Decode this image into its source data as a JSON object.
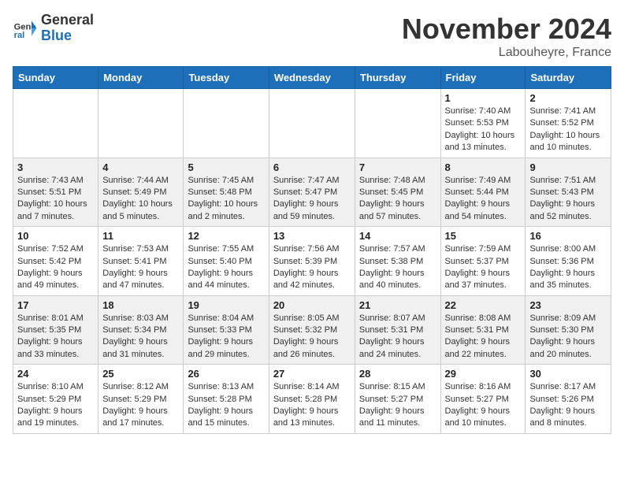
{
  "logo": {
    "general": "General",
    "blue": "Blue"
  },
  "title": "November 2024",
  "location": "Labouheyre, France",
  "days_of_week": [
    "Sunday",
    "Monday",
    "Tuesday",
    "Wednesday",
    "Thursday",
    "Friday",
    "Saturday"
  ],
  "weeks": [
    [
      {
        "day": "",
        "info": ""
      },
      {
        "day": "",
        "info": ""
      },
      {
        "day": "",
        "info": ""
      },
      {
        "day": "",
        "info": ""
      },
      {
        "day": "",
        "info": ""
      },
      {
        "day": "1",
        "info": "Sunrise: 7:40 AM\nSunset: 5:53 PM\nDaylight: 10 hours and 13 minutes."
      },
      {
        "day": "2",
        "info": "Sunrise: 7:41 AM\nSunset: 5:52 PM\nDaylight: 10 hours and 10 minutes."
      }
    ],
    [
      {
        "day": "3",
        "info": "Sunrise: 7:43 AM\nSunset: 5:51 PM\nDaylight: 10 hours and 7 minutes."
      },
      {
        "day": "4",
        "info": "Sunrise: 7:44 AM\nSunset: 5:49 PM\nDaylight: 10 hours and 5 minutes."
      },
      {
        "day": "5",
        "info": "Sunrise: 7:45 AM\nSunset: 5:48 PM\nDaylight: 10 hours and 2 minutes."
      },
      {
        "day": "6",
        "info": "Sunrise: 7:47 AM\nSunset: 5:47 PM\nDaylight: 9 hours and 59 minutes."
      },
      {
        "day": "7",
        "info": "Sunrise: 7:48 AM\nSunset: 5:45 PM\nDaylight: 9 hours and 57 minutes."
      },
      {
        "day": "8",
        "info": "Sunrise: 7:49 AM\nSunset: 5:44 PM\nDaylight: 9 hours and 54 minutes."
      },
      {
        "day": "9",
        "info": "Sunrise: 7:51 AM\nSunset: 5:43 PM\nDaylight: 9 hours and 52 minutes."
      }
    ],
    [
      {
        "day": "10",
        "info": "Sunrise: 7:52 AM\nSunset: 5:42 PM\nDaylight: 9 hours and 49 minutes."
      },
      {
        "day": "11",
        "info": "Sunrise: 7:53 AM\nSunset: 5:41 PM\nDaylight: 9 hours and 47 minutes."
      },
      {
        "day": "12",
        "info": "Sunrise: 7:55 AM\nSunset: 5:40 PM\nDaylight: 9 hours and 44 minutes."
      },
      {
        "day": "13",
        "info": "Sunrise: 7:56 AM\nSunset: 5:39 PM\nDaylight: 9 hours and 42 minutes."
      },
      {
        "day": "14",
        "info": "Sunrise: 7:57 AM\nSunset: 5:38 PM\nDaylight: 9 hours and 40 minutes."
      },
      {
        "day": "15",
        "info": "Sunrise: 7:59 AM\nSunset: 5:37 PM\nDaylight: 9 hours and 37 minutes."
      },
      {
        "day": "16",
        "info": "Sunrise: 8:00 AM\nSunset: 5:36 PM\nDaylight: 9 hours and 35 minutes."
      }
    ],
    [
      {
        "day": "17",
        "info": "Sunrise: 8:01 AM\nSunset: 5:35 PM\nDaylight: 9 hours and 33 minutes."
      },
      {
        "day": "18",
        "info": "Sunrise: 8:03 AM\nSunset: 5:34 PM\nDaylight: 9 hours and 31 minutes."
      },
      {
        "day": "19",
        "info": "Sunrise: 8:04 AM\nSunset: 5:33 PM\nDaylight: 9 hours and 29 minutes."
      },
      {
        "day": "20",
        "info": "Sunrise: 8:05 AM\nSunset: 5:32 PM\nDaylight: 9 hours and 26 minutes."
      },
      {
        "day": "21",
        "info": "Sunrise: 8:07 AM\nSunset: 5:31 PM\nDaylight: 9 hours and 24 minutes."
      },
      {
        "day": "22",
        "info": "Sunrise: 8:08 AM\nSunset: 5:31 PM\nDaylight: 9 hours and 22 minutes."
      },
      {
        "day": "23",
        "info": "Sunrise: 8:09 AM\nSunset: 5:30 PM\nDaylight: 9 hours and 20 minutes."
      }
    ],
    [
      {
        "day": "24",
        "info": "Sunrise: 8:10 AM\nSunset: 5:29 PM\nDaylight: 9 hours and 19 minutes."
      },
      {
        "day": "25",
        "info": "Sunrise: 8:12 AM\nSunset: 5:29 PM\nDaylight: 9 hours and 17 minutes."
      },
      {
        "day": "26",
        "info": "Sunrise: 8:13 AM\nSunset: 5:28 PM\nDaylight: 9 hours and 15 minutes."
      },
      {
        "day": "27",
        "info": "Sunrise: 8:14 AM\nSunset: 5:28 PM\nDaylight: 9 hours and 13 minutes."
      },
      {
        "day": "28",
        "info": "Sunrise: 8:15 AM\nSunset: 5:27 PM\nDaylight: 9 hours and 11 minutes."
      },
      {
        "day": "29",
        "info": "Sunrise: 8:16 AM\nSunset: 5:27 PM\nDaylight: 9 hours and 10 minutes."
      },
      {
        "day": "30",
        "info": "Sunrise: 8:17 AM\nSunset: 5:26 PM\nDaylight: 9 hours and 8 minutes."
      }
    ]
  ]
}
